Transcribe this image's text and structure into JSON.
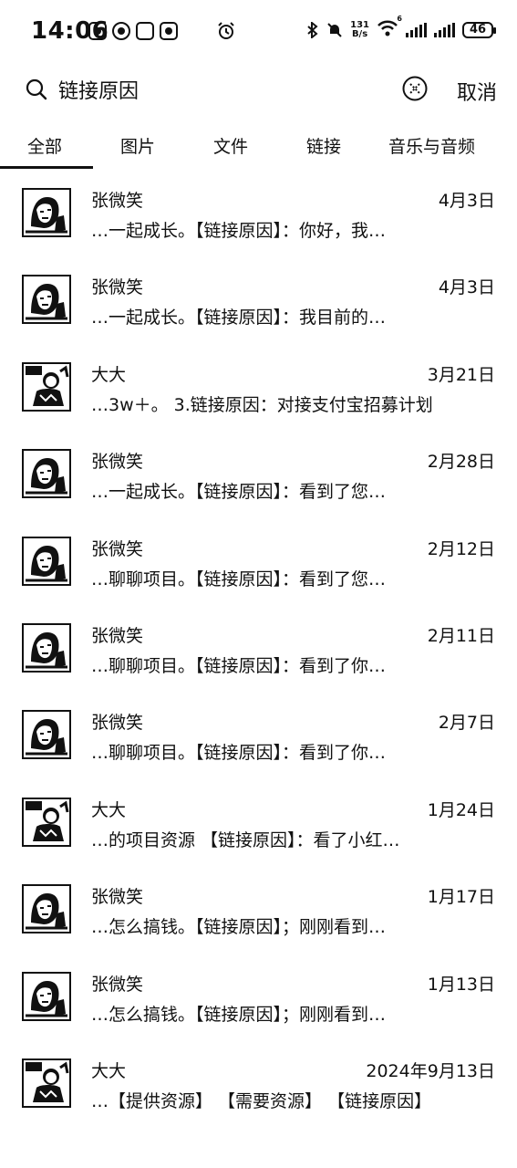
{
  "status_bar": {
    "time": "14:06",
    "net_speed_value": "131",
    "net_speed_unit": "B/s",
    "network_badge": "6",
    "battery": "46"
  },
  "search": {
    "query": "链接原因",
    "cancel_label": "取消"
  },
  "tabs": [
    "全部",
    "图片",
    "文件",
    "链接",
    "音乐与音频"
  ],
  "results": [
    {
      "name": "张微笑",
      "date": "4月3日",
      "snippet": "…一起成长。【链接原因】：你好，我…",
      "avatar": "avatar-zhang"
    },
    {
      "name": "张微笑",
      "date": "4月3日",
      "snippet": "…一起成长。【链接原因】：我目前的…",
      "avatar": "avatar-zhang"
    },
    {
      "name": "大大",
      "date": "3月21日",
      "snippet": "…3w＋。 3.链接原因：对接支付宝招募计划",
      "avatar": "avatar-dada"
    },
    {
      "name": "张微笑",
      "date": "2月28日",
      "snippet": "…一起成长。【链接原因】：看到了您…",
      "avatar": "avatar-zhang"
    },
    {
      "name": "张微笑",
      "date": "2月12日",
      "snippet": "…聊聊项目。【链接原因】：看到了您…",
      "avatar": "avatar-zhang"
    },
    {
      "name": "张微笑",
      "date": "2月11日",
      "snippet": "…聊聊项目。【链接原因】：看到了你…",
      "avatar": "avatar-zhang"
    },
    {
      "name": "张微笑",
      "date": "2月7日",
      "snippet": "…聊聊项目。【链接原因】：看到了你…",
      "avatar": "avatar-zhang"
    },
    {
      "name": "大大",
      "date": "1月24日",
      "snippet": "…的项目资源 【链接原因】：看了小红…",
      "avatar": "avatar-dada"
    },
    {
      "name": "张微笑",
      "date": "1月17日",
      "snippet": "…怎么搞钱。【链接原因】；刚刚看到…",
      "avatar": "avatar-zhang"
    },
    {
      "name": "张微笑",
      "date": "1月13日",
      "snippet": "…怎么搞钱。【链接原因】；刚刚看到…",
      "avatar": "avatar-zhang"
    },
    {
      "name": "大大",
      "date": "2024年9月13日",
      "snippet": "…【提供资源】 【需要资源】 【链接原因】",
      "avatar": "avatar-dada"
    }
  ]
}
